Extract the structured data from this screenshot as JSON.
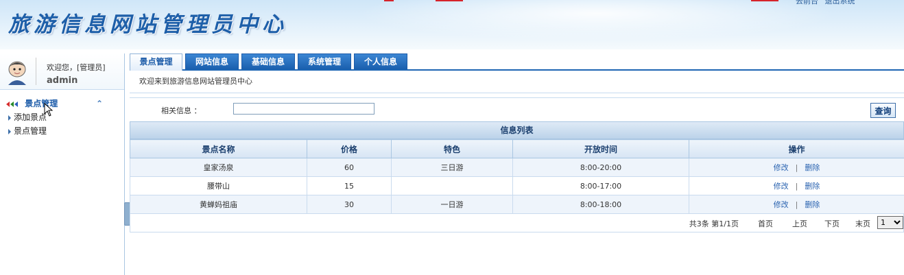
{
  "header": {
    "title": "旅游信息网站管理员中心",
    "links": [
      "去前台",
      "退出系统"
    ]
  },
  "sidebar": {
    "welcome": "欢迎您，[管理员]",
    "username": "admin",
    "menu_title": "景点管理",
    "items": [
      "添加景点",
      "景点管理"
    ]
  },
  "tabs": [
    "景点管理",
    "网站信息",
    "基础信息",
    "系统管理",
    "个人信息"
  ],
  "welcome_message": "欢迎来到旅游信息网站管理员中心",
  "search": {
    "label": "相关信息 ：",
    "value": "",
    "button": "查询"
  },
  "list": {
    "title": "信息列表",
    "columns": [
      "景点名称",
      "价格",
      "特色",
      "开放时间",
      "操作"
    ],
    "rows": [
      {
        "name": "皇家汤泉",
        "price": "60",
        "feature": "三日游",
        "hours": "8:00-20:00"
      },
      {
        "name": "腰带山",
        "price": "15",
        "feature": "",
        "hours": "8:00-17:00"
      },
      {
        "name": "黄蝉妈祖庙",
        "price": "30",
        "feature": "一日游",
        "hours": "8:00-18:00"
      }
    ],
    "actions": {
      "edit": "修改",
      "separator": "|",
      "delete": "删除"
    }
  },
  "pager": {
    "info": "共3条  第1/1页",
    "first": "首页",
    "prev": "上页",
    "next": "下页",
    "last": "末页",
    "page_select": "1"
  },
  "colors": {
    "title_blue": "#1e5fa9",
    "tab_blue": "#1a5fae",
    "link_blue": "#2a63b0",
    "border": "#a9c6e2"
  }
}
